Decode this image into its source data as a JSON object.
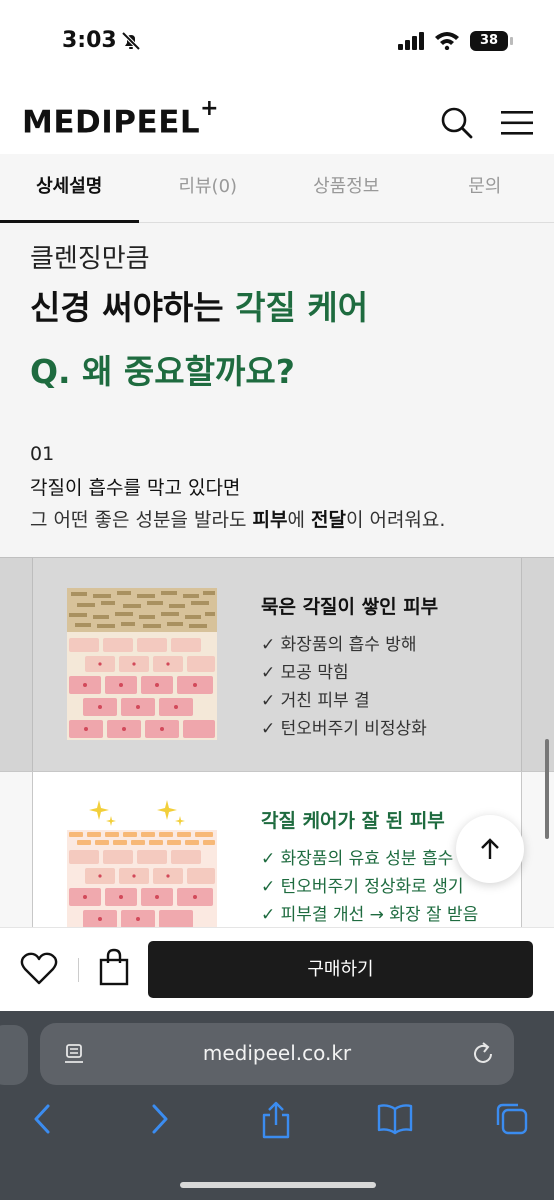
{
  "status": {
    "time": "3:03",
    "battery": "38"
  },
  "header": {
    "logo": "MEDIPEEL",
    "logo_sup": "+"
  },
  "tabs": [
    {
      "label": "상세설명",
      "active": true
    },
    {
      "label": "리뷰(0)",
      "active": false
    },
    {
      "label": "상품정보",
      "active": false
    },
    {
      "label": "문의",
      "active": false
    }
  ],
  "content": {
    "subtitle": "클렌징만큼",
    "title_prefix": "신경 써야하는 ",
    "title_highlight": "각질 케어",
    "question": "Q. 왜 중요할까요?",
    "number": "01",
    "line1": "각질이 흡수를 막고 있다면",
    "line2_prefix": "그 어떤 좋은 성분을 발라도 ",
    "line2_bold1": "피부",
    "line2_mid": "에 ",
    "line2_bold2": "전달",
    "line2_suffix": "이 어려워요."
  },
  "panels": [
    {
      "title": "묵은 각질이 쌓인 피부",
      "items": [
        "✓ 화장품의 흡수 방해",
        "✓ 모공 막힘",
        "✓ 거친 피부 결",
        "✓ 턴오버주기 비정상화"
      ]
    },
    {
      "title": "각질 케어가 잘 된 피부",
      "items": [
        "✓ 화장품의 유효 성분 흡수",
        "✓ 턴오버주기 정상화로 생기",
        "✓ 피부결 개선 → 화장 잘 받음"
      ]
    }
  ],
  "buybar": {
    "buy_label": "구매하기"
  },
  "safari": {
    "url": "medipeel.co.kr"
  },
  "colors": {
    "brand_green": "#1e6b3f",
    "buy_button": "#1b1b1b",
    "safari_bar": "#44494f",
    "safari_icon": "#3b8cf0"
  }
}
